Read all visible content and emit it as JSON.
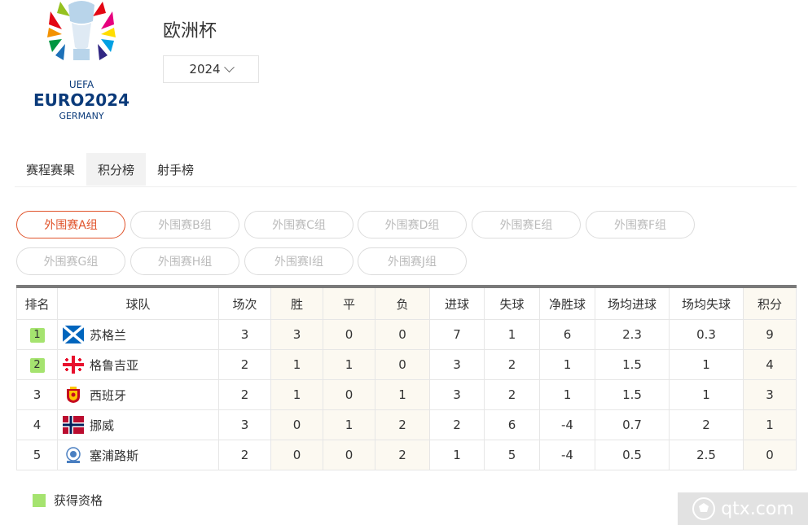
{
  "logo": {
    "brand": "UEFA",
    "name": "EURO2024",
    "host": "GERMANY"
  },
  "competition": {
    "title": "欧洲杯",
    "season": "2024"
  },
  "tabs": [
    {
      "label": "赛程赛果",
      "active": false
    },
    {
      "label": "积分榜",
      "active": true
    },
    {
      "label": "射手榜",
      "active": false
    }
  ],
  "groups": [
    "外围赛A组",
    "外围赛B组",
    "外围赛C组",
    "外围赛D组",
    "外围赛E组",
    "外围赛F组",
    "外围赛G组",
    "外围赛H组",
    "外围赛I组",
    "外围赛J组"
  ],
  "active_group": "外围赛A组",
  "table": {
    "headers": [
      "排名",
      "球队",
      "场次",
      "胜",
      "平",
      "负",
      "进球",
      "失球",
      "净胜球",
      "场均进球",
      "场均失球",
      "积分"
    ],
    "rows": [
      {
        "rank": "1",
        "qualified": true,
        "team": "苏格兰",
        "flag": "scotland-flag-icon",
        "played": "3",
        "win": "3",
        "draw": "0",
        "loss": "0",
        "gf": "7",
        "ga": "1",
        "gd": "6",
        "avg_gf": "2.3",
        "avg_ga": "0.3",
        "pts": "9"
      },
      {
        "rank": "2",
        "qualified": true,
        "team": "格鲁吉亚",
        "flag": "georgia-flag-icon",
        "played": "2",
        "win": "1",
        "draw": "1",
        "loss": "0",
        "gf": "3",
        "ga": "2",
        "gd": "1",
        "avg_gf": "1.5",
        "avg_ga": "1",
        "pts": "4"
      },
      {
        "rank": "3",
        "qualified": false,
        "team": "西班牙",
        "flag": "spain-crest-icon",
        "played": "2",
        "win": "1",
        "draw": "0",
        "loss": "1",
        "gf": "3",
        "ga": "2",
        "gd": "1",
        "avg_gf": "1.5",
        "avg_ga": "1",
        "pts": "3"
      },
      {
        "rank": "4",
        "qualified": false,
        "team": "挪威",
        "flag": "norway-flag-icon",
        "played": "3",
        "win": "0",
        "draw": "1",
        "loss": "2",
        "gf": "2",
        "ga": "6",
        "gd": "-4",
        "avg_gf": "0.7",
        "avg_ga": "2",
        "pts": "1"
      },
      {
        "rank": "5",
        "qualified": false,
        "team": "塞浦路斯",
        "flag": "cyprus-crest-icon",
        "played": "2",
        "win": "0",
        "draw": "0",
        "loss": "2",
        "gf": "1",
        "ga": "5",
        "gd": "-4",
        "avg_gf": "0.5",
        "avg_ga": "2.5",
        "pts": "0"
      }
    ]
  },
  "legend": {
    "label": "获得资格",
    "color": "#a5e36f"
  },
  "watermark": {
    "text": "qtx.com"
  },
  "colors": {
    "accent": "#e0532b",
    "qualified": "#a5e36f",
    "shade": "#fcf9f1"
  }
}
